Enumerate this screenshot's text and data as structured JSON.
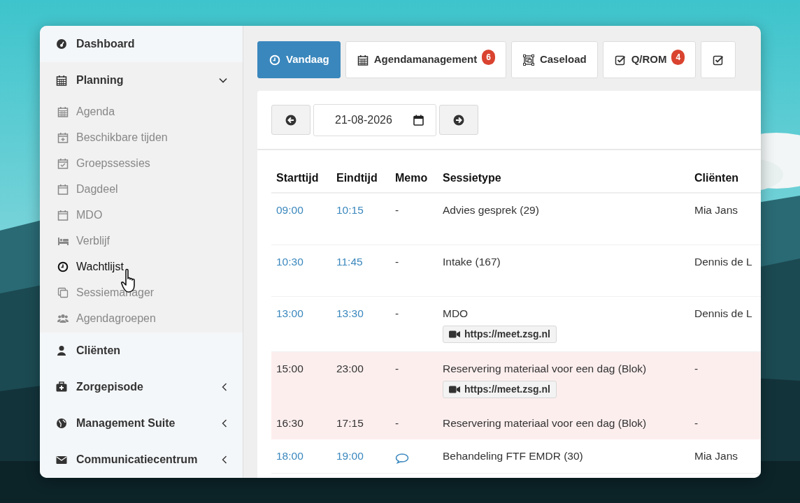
{
  "sidebar": {
    "items": [
      {
        "kind": "link",
        "label": "Dashboard"
      },
      {
        "kind": "group",
        "label": "Planning",
        "expanded": true,
        "children": [
          {
            "label": "Agenda",
            "hovered": false
          },
          {
            "label": "Beschikbare tijden",
            "hovered": false
          },
          {
            "label": "Groepssessies",
            "hovered": false
          },
          {
            "label": "Dagdeel",
            "hovered": false
          },
          {
            "label": "MDO",
            "hovered": false
          },
          {
            "label": "Verblijf",
            "hovered": false
          },
          {
            "label": "Wachtlijst",
            "hovered": true
          },
          {
            "label": "Sessiemanager",
            "hovered": false
          },
          {
            "label": "Agendagroepen",
            "hovered": false
          }
        ]
      },
      {
        "kind": "link",
        "label": "Cliënten"
      },
      {
        "kind": "group",
        "label": "Zorgepisode",
        "expanded": false
      },
      {
        "kind": "group",
        "label": "Management Suite",
        "expanded": false
      },
      {
        "kind": "group",
        "label": "Communicatiecentrum",
        "expanded": false
      }
    ]
  },
  "tabs": [
    {
      "label": "Vandaag",
      "selected": true
    },
    {
      "label": "Agendamanagement",
      "badge": "6",
      "selected": false
    },
    {
      "label": "Caseload",
      "selected": false
    },
    {
      "label": "Q/ROM",
      "badge": "4",
      "selected": false
    },
    {
      "selected": false
    }
  ],
  "date_nav": {
    "value": "21-08-2026"
  },
  "table": {
    "columns": [
      "Starttijd",
      "Eindtijd",
      "Memo",
      "Sessietype",
      "Cliënten"
    ],
    "rows": [
      {
        "kind": "session",
        "start": "09:00",
        "end": "10:15",
        "memo": {
          "kind": "text",
          "text": "-"
        },
        "session": "Advies gesprek (29)",
        "client": "Mia Jans"
      },
      {
        "kind": "session",
        "start": "10:30",
        "end": "11:45",
        "memo": {
          "kind": "text",
          "text": "-"
        },
        "session": "Intake (167)",
        "client": "Dennis de L"
      },
      {
        "kind": "session",
        "start": "13:00",
        "end": "13:30",
        "memo": {
          "kind": "text",
          "text": "-"
        },
        "session": "MDO",
        "link": "https://meet.zsg.nl",
        "client": "Dennis de L"
      },
      {
        "kind": "block",
        "start": "15:00",
        "end": "23:00",
        "memo": {
          "kind": "text",
          "text": "-"
        },
        "session": "Reservering materiaal voor een dag (Blok)",
        "link": "https://meet.zsg.nl",
        "client": "-"
      },
      {
        "kind": "block",
        "start": "16:30",
        "end": "17:15",
        "memo": {
          "kind": "text",
          "text": "-"
        },
        "session": "Reservering materiaal voor een dag (Blok)",
        "client": "-"
      },
      {
        "kind": "session",
        "start": "18:00",
        "end": "19:00",
        "memo": {
          "kind": "comment"
        },
        "session": "Behandeling FTF EMDR (30)",
        "client": "Mia Jans"
      }
    ]
  }
}
